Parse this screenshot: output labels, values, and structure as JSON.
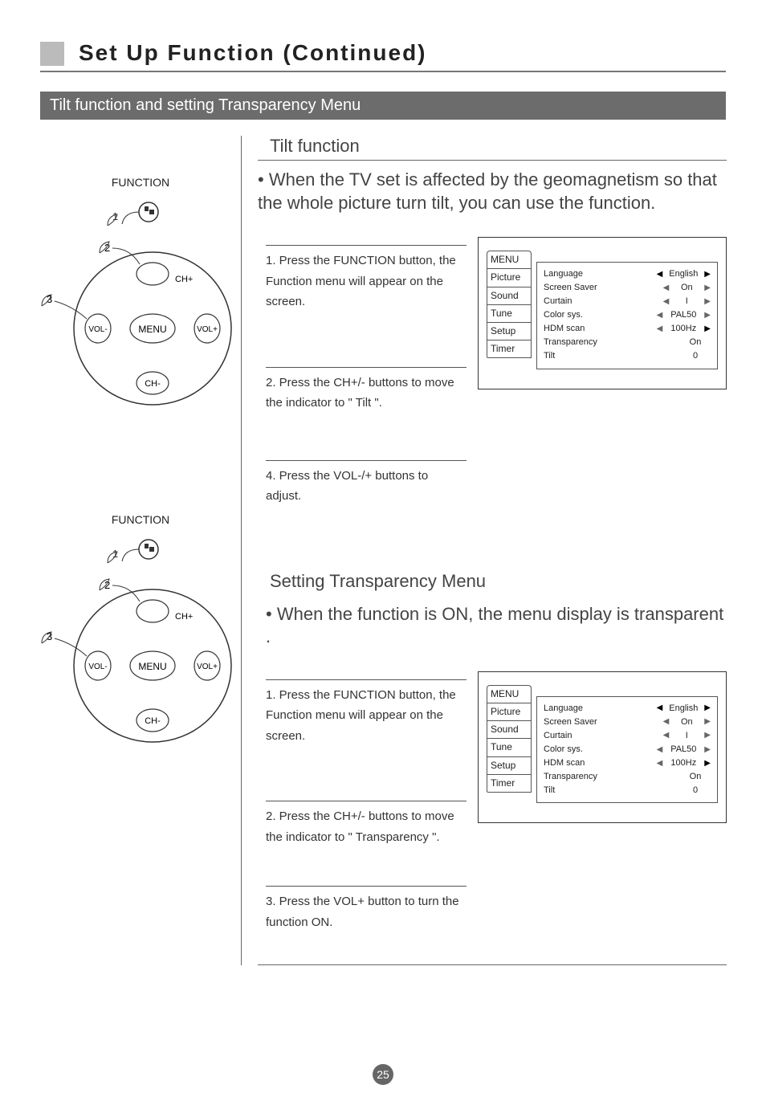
{
  "page_title": "Set Up Function (Continued)",
  "section_bar": "Tilt function and setting Transparency Menu",
  "page_number": "25",
  "function_label": "FUNCTION",
  "remote": {
    "ch_plus": "CH+",
    "ch_minus": "CH-",
    "vol_plus": "VOL+",
    "vol_minus": "VOL-",
    "menu": "MENU"
  },
  "tilt": {
    "heading": "Tilt function",
    "intro": "When the TV set is affected by the geomagnetism so that the whole picture turn tilt, you can use the function.",
    "step1": "1. Press the FUNCTION button, the Function menu will appear on the screen.",
    "step2": "2. Press the CH+/- buttons to move the indicator to \" Tilt \".",
    "step4": "4. Press the  VOL-/+ buttons to adjust."
  },
  "transparency": {
    "heading": "Setting Transparency Menu",
    "intro": "When the function is ON, the menu display is transparent .",
    "step1": "1. Press the FUNCTION button, the Function menu will appear on the screen.",
    "step2": "2. Press the CH+/- buttons to move the indicator to \" Transparency \".",
    "step3": "3. Press the VOL+ button to turn the function ON."
  },
  "osd": {
    "tab_menu": "MENU",
    "tab_picture": "Picture",
    "tab_sound": "Sound",
    "tab_tune": "Tune",
    "tab_setup": "Setup",
    "tab_timer": "Timer",
    "rows": {
      "language": {
        "lbl": "Language",
        "val": "English"
      },
      "screen_saver": {
        "lbl": "Screen Saver",
        "val": "On"
      },
      "curtain": {
        "lbl": "Curtain",
        "val": "I"
      },
      "color_sys": {
        "lbl": "Color sys.",
        "val": "PAL50"
      },
      "hdm_scan": {
        "lbl": "HDM scan",
        "val": "100Hz"
      },
      "transparency": {
        "lbl": "Transparency",
        "val": "On"
      },
      "tilt": {
        "lbl": "Tilt",
        "val": "0"
      }
    }
  }
}
